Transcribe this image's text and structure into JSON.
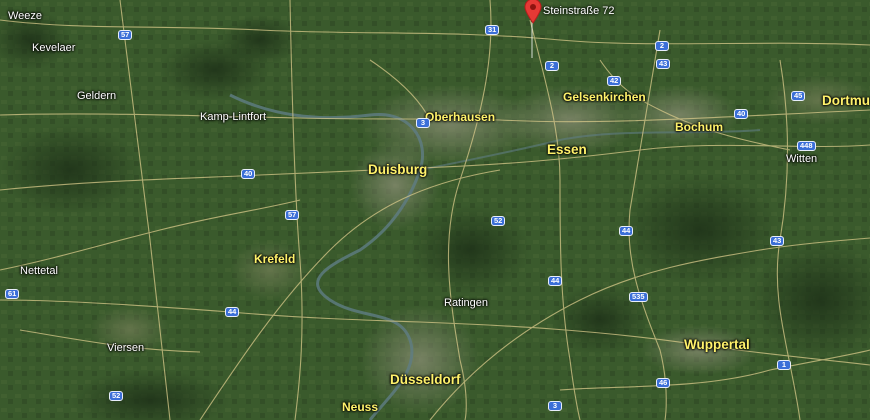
{
  "map": {
    "view": "satellite",
    "colors": {
      "terrain": "#3a5a2c",
      "roads": "#d8c98a",
      "river": "#5f7d84",
      "shield": "#3b6fd8",
      "city_label": "#fff26b",
      "pin": "#e53935"
    }
  },
  "marker": {
    "label": "Steinstraße 72",
    "icon": "map-pin-icon"
  },
  "places": [
    {
      "id": "weeze",
      "name": "Weeze",
      "type": "town"
    },
    {
      "id": "kevelaer",
      "name": "Kevelaer",
      "type": "town"
    },
    {
      "id": "geldern",
      "name": "Geldern",
      "type": "town"
    },
    {
      "id": "kamp-lintfort",
      "name": "Kamp-Lintfort",
      "type": "town"
    },
    {
      "id": "oberhausen",
      "name": "Oberhausen",
      "type": "city"
    },
    {
      "id": "gelsenkirchen",
      "name": "Gelsenkirchen",
      "type": "city"
    },
    {
      "id": "essen",
      "name": "Essen",
      "type": "bigcity"
    },
    {
      "id": "bochum",
      "name": "Bochum",
      "type": "city"
    },
    {
      "id": "dortmund",
      "name": "Dortmu",
      "type": "bigcity"
    },
    {
      "id": "witten",
      "name": "Witten",
      "type": "town"
    },
    {
      "id": "duisburg",
      "name": "Duisburg",
      "type": "bigcity"
    },
    {
      "id": "krefeld",
      "name": "Krefeld",
      "type": "city"
    },
    {
      "id": "nettetal",
      "name": "Nettetal",
      "type": "town"
    },
    {
      "id": "ratingen",
      "name": "Ratingen",
      "type": "town"
    },
    {
      "id": "viersen",
      "name": "Viersen",
      "type": "town"
    },
    {
      "id": "wuppertal",
      "name": "Wuppertal",
      "type": "bigcity"
    },
    {
      "id": "duesseldorf",
      "name": "Düsseldorf",
      "type": "bigcity"
    },
    {
      "id": "neuss",
      "name": "Neuss",
      "type": "city"
    }
  ],
  "road_shields": [
    "57",
    "31",
    "2",
    "2",
    "43",
    "42",
    "3",
    "45",
    "40",
    "448",
    "40",
    "57",
    "52",
    "44",
    "43",
    "61",
    "44",
    "44",
    "535",
    "46",
    "1",
    "52",
    "3"
  ]
}
